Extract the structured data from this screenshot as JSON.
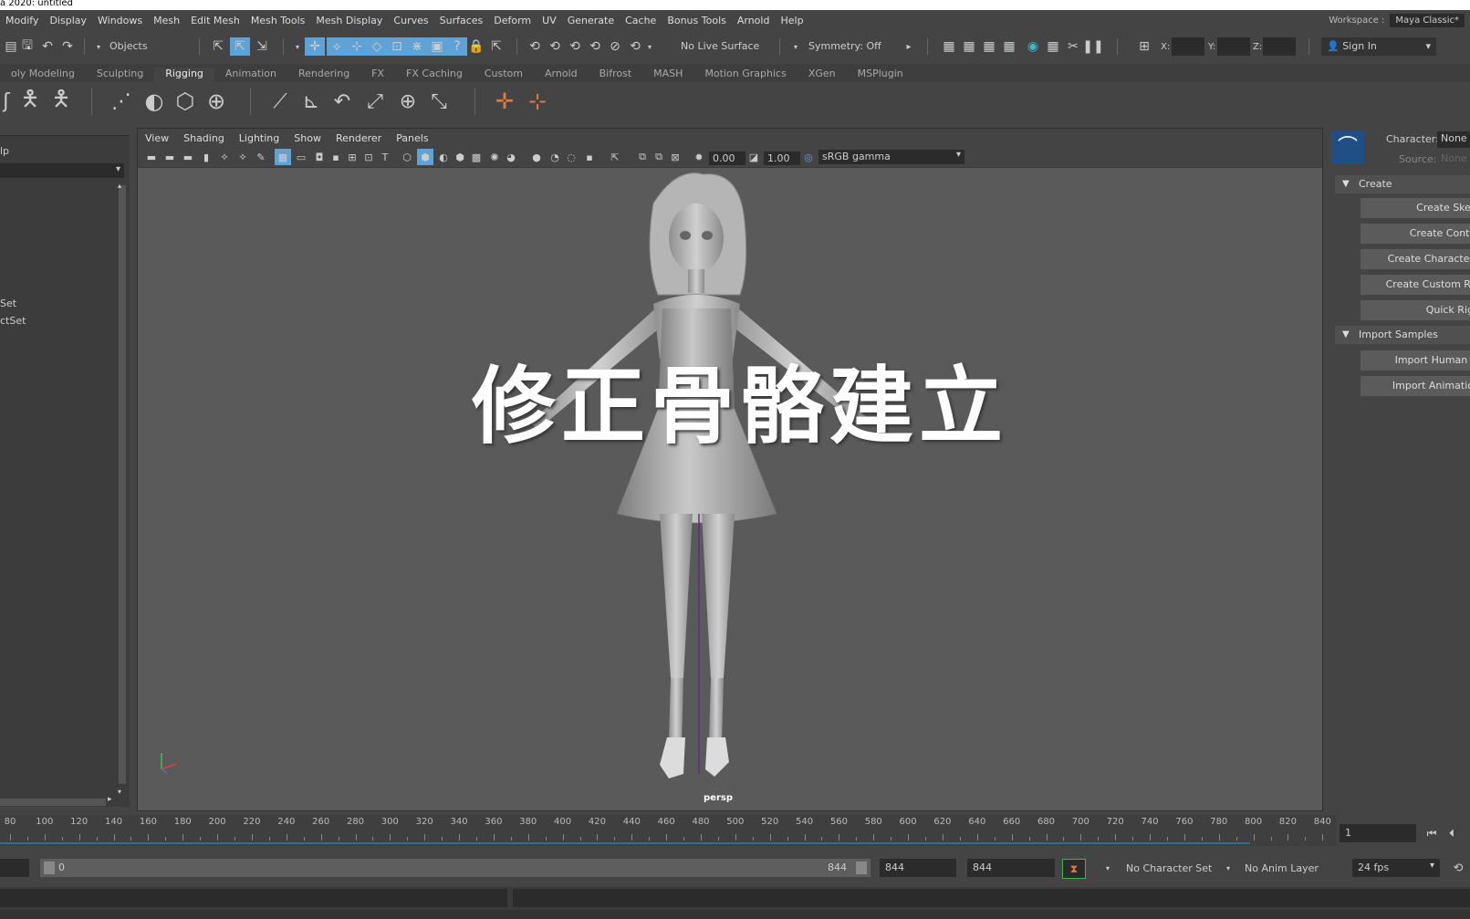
{
  "app": {
    "title": "a 2020: untitled"
  },
  "menubar": {
    "items": [
      "Modify",
      "Display",
      "Windows",
      "Mesh",
      "Edit Mesh",
      "Mesh Tools",
      "Mesh Display",
      "Curves",
      "Surfaces",
      "Deform",
      "UV",
      "Generate",
      "Cache",
      "Bonus Tools",
      "Arnold",
      "Help"
    ],
    "workspace_label": "Workspace :",
    "workspace_value": "Maya Classic*"
  },
  "statusline": {
    "selection_mode": "Objects",
    "live_surface": "No Live Surface",
    "symmetry": "Symmetry: Off",
    "x_label": "X:",
    "y_label": "Y:",
    "z_label": "Z:",
    "sign_in": "Sign In"
  },
  "shelf": {
    "tabs": [
      "oly Modeling",
      "Sculpting",
      "Rigging",
      "Animation",
      "Rendering",
      "FX",
      "FX Caching",
      "Custom",
      "Arnold",
      "Bifrost",
      "MASH",
      "Motion Graphics",
      "XGen",
      "MSPlugin"
    ],
    "active_tab": "Rigging"
  },
  "outliner": {
    "header": "lp",
    "items": [
      "Set",
      "ctSet"
    ]
  },
  "viewport": {
    "menu": [
      "View",
      "Shading",
      "Lighting",
      "Show",
      "Renderer",
      "Panels"
    ],
    "exposure": "0.00",
    "gamma": "1.00",
    "color_space": "sRGB gamma",
    "camera_label": "persp",
    "overlay_text": "修正骨骼建立"
  },
  "character_controls": {
    "character_label": "Character:",
    "character_value": "None",
    "source_label": "Source:",
    "source_value": "None",
    "create_section": "Create",
    "create_buttons": [
      "Create Skel",
      "Create Contr",
      "Create Character",
      "Create Custom Ri",
      "Quick Rig"
    ],
    "import_section": "Import Samples",
    "import_buttons": [
      "Import Human I",
      "Import Animatio"
    ]
  },
  "timeline": {
    "ticks": [
      "80",
      "100",
      "120",
      "140",
      "160",
      "180",
      "200",
      "220",
      "240",
      "260",
      "280",
      "300",
      "320",
      "340",
      "360",
      "380",
      "400",
      "420",
      "440",
      "460",
      "480",
      "500",
      "520",
      "540",
      "560",
      "580",
      "600",
      "620",
      "640",
      "660",
      "680",
      "700",
      "720",
      "740",
      "760",
      "780",
      "800",
      "820",
      "840"
    ],
    "current_frame": "1"
  },
  "range": {
    "start": "0",
    "slider_end": "844",
    "playback_end": "844",
    "animation_end": "844",
    "character_set": "No Character Set",
    "anim_layer": "No Anim Layer",
    "fps": "24 fps"
  },
  "colors": {
    "active_tool": "#5fa3d6",
    "accent_orange": "#e07b39"
  }
}
